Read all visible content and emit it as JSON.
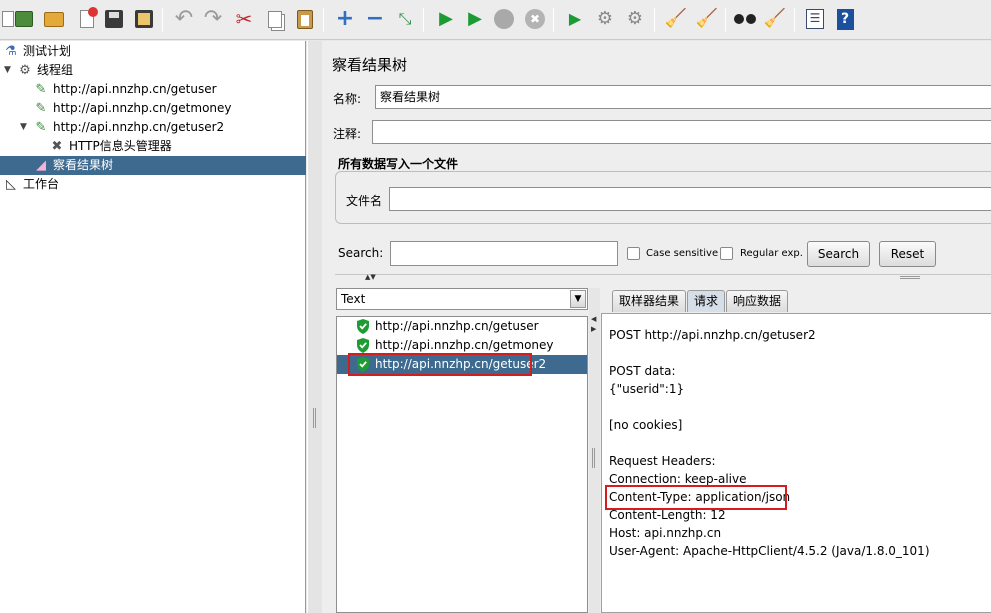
{
  "toolbar": {
    "buttons": [
      {
        "icon": "new-icon",
        "glyph": "📄"
      },
      {
        "icon": "templates-icon",
        "glyph": "📗"
      },
      {
        "icon": "open-icon",
        "glyph": "📂"
      },
      {
        "icon": "close-icon",
        "glyph": "🚫"
      },
      {
        "icon": "save-icon",
        "glyph": "💾"
      },
      {
        "icon": "save-screenshot-icon",
        "glyph": "📝"
      },
      {
        "icon": "undo-icon",
        "glyph": "↶"
      },
      {
        "icon": "redo-icon",
        "glyph": "↷"
      },
      {
        "icon": "cut-icon",
        "glyph": "✂"
      },
      {
        "icon": "copy-icon",
        "glyph": "⎘"
      },
      {
        "icon": "paste-icon",
        "glyph": "📋"
      },
      {
        "icon": "expand-icon",
        "glyph": "+"
      },
      {
        "icon": "collapse-icon",
        "glyph": "−"
      },
      {
        "icon": "toggle-icon",
        "glyph": "⤡"
      },
      {
        "icon": "start-icon",
        "glyph": "▶"
      },
      {
        "icon": "start-no-pause-icon",
        "glyph": "▶"
      },
      {
        "icon": "stop-icon",
        "glyph": "⬣"
      },
      {
        "icon": "shutdown-icon",
        "glyph": "✖"
      },
      {
        "icon": "remote-start-icon",
        "glyph": "▶"
      },
      {
        "icon": "remote-stop-icon",
        "glyph": "⚙"
      },
      {
        "icon": "remote-exit-icon",
        "glyph": "⚙"
      },
      {
        "icon": "clear-icon",
        "glyph": "🧹"
      },
      {
        "icon": "clear-all-icon",
        "glyph": "🧹"
      },
      {
        "icon": "search-icon",
        "glyph": "🔭"
      },
      {
        "icon": "reset-search-icon",
        "glyph": "🧹"
      },
      {
        "icon": "function-helper-icon",
        "glyph": "☰"
      },
      {
        "icon": "help-icon",
        "glyph": "?"
      }
    ]
  },
  "tree": {
    "items": [
      {
        "label": "测试计划",
        "icon": "test-plan-icon"
      },
      {
        "label": "线程组",
        "icon": "thread-group-icon"
      },
      {
        "label": "http://api.nnzhp.cn/getuser",
        "icon": "sampler-icon"
      },
      {
        "label": "http://api.nnzhp.cn/getmoney",
        "icon": "sampler-icon"
      },
      {
        "label": "http://api.nnzhp.cn/getuser2",
        "icon": "sampler-icon"
      },
      {
        "label": "HTTP信息头管理器",
        "icon": "header-manager-icon"
      },
      {
        "label": "察看结果树",
        "icon": "listener-icon"
      },
      {
        "label": "工作台",
        "icon": "workbench-icon"
      }
    ]
  },
  "panel": {
    "title": "察看结果树",
    "name_label": "名称:",
    "name_value": "察看结果树",
    "comment_label": "注释:",
    "comment_value": "",
    "file_section_title": "所有数据写入一个文件",
    "filename_label": "文件名",
    "filename_value": "",
    "search_label": "Search:",
    "search_value": "",
    "case_sensitive_label": "Case sensitive",
    "regular_exp_label": "Regular exp.",
    "search_button": "Search",
    "reset_button": "Reset"
  },
  "results": {
    "renderer_selected": "Text",
    "items": [
      {
        "label": "http://api.nnzhp.cn/getuser",
        "status": "success"
      },
      {
        "label": "http://api.nnzhp.cn/getmoney",
        "status": "success"
      },
      {
        "label": "http://api.nnzhp.cn/getuser2",
        "status": "success"
      }
    ]
  },
  "tabs": [
    {
      "label": "取样器结果"
    },
    {
      "label": "请求"
    },
    {
      "label": "响应数据"
    }
  ],
  "request": {
    "lines": [
      "POST http://api.nnzhp.cn/getuser2",
      "",
      "POST data:",
      "{\"userid\":1}",
      "",
      "[no cookies]",
      "",
      "Request Headers:",
      "Connection: keep-alive",
      "Content-Type: application/json",
      "Content-Length: 12",
      "Host: api.nnzhp.cn",
      "User-Agent: Apache-HttpClient/4.5.2 (Java/1.8.0_101)"
    ]
  },
  "colors": {
    "selection": "#3d6a8e",
    "highlight_box": "#d61c1c",
    "success": "#1e9b32"
  }
}
